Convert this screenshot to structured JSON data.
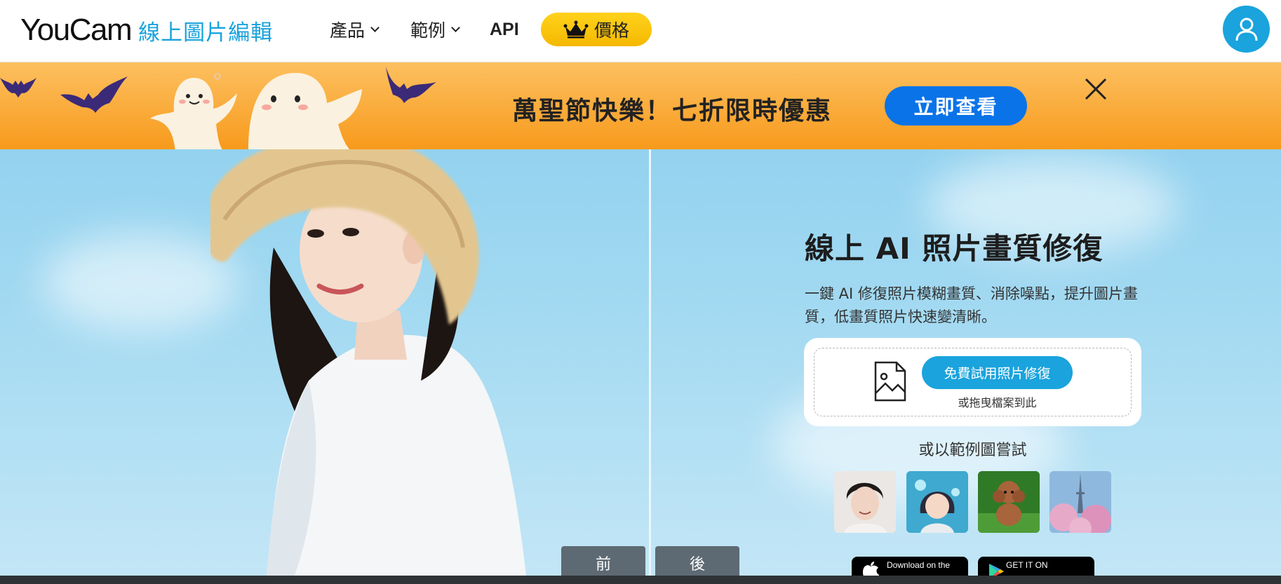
{
  "header": {
    "logo_main": "YouCam",
    "logo_sub": "線上圖片編輯",
    "nav": {
      "products": "產品",
      "examples": "範例",
      "api": "API"
    },
    "price_label": "價格"
  },
  "promo": {
    "text": "萬聖節快樂！七折限時優惠",
    "button": "立即查看"
  },
  "hero": {
    "before_label": "前",
    "after_label": "後",
    "title": "線上 AI 照片畫質修復",
    "description": "一鍵 AI 修復照片模糊畫質、消除噪點，提升圖片畫質，低畫質照片快速變清晰。",
    "upload_button": "免費試用照片修復",
    "upload_hint": "或拖曳檔案到此",
    "samples_label": "或以範例圖嘗試"
  },
  "store": {
    "appstore_small": "Download on the",
    "googleplay_small": "GET IT ON"
  },
  "colors": {
    "brand_blue": "#1aa3dd",
    "promo_button": "#0a73e8",
    "price_yellow": "#ffd21c",
    "promo_orange": "#f79a1c"
  },
  "icons": [
    "crown-icon",
    "chevron-down-icon",
    "user-icon",
    "close-icon",
    "bat-icon",
    "ghost-icon",
    "image-file-icon",
    "apple-icon",
    "google-play-icon"
  ]
}
